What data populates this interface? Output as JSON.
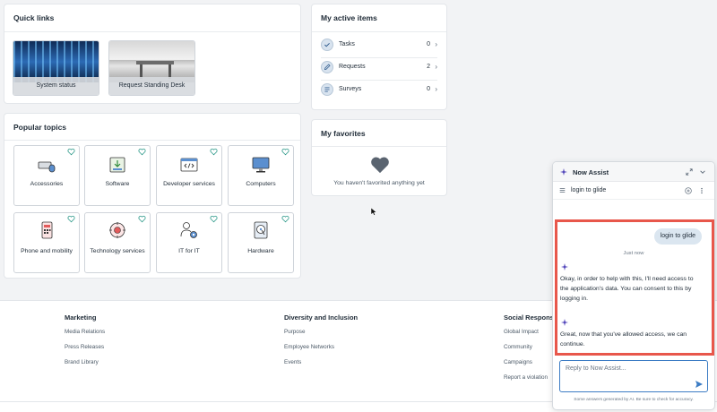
{
  "quick_links": {
    "title": "Quick links",
    "tiles": [
      {
        "label": "System status"
      },
      {
        "label": "Request Standing Desk"
      }
    ]
  },
  "popular_topics": {
    "title": "Popular topics",
    "tiles": [
      {
        "label": "Accessories",
        "icon": "keyboard-mouse-icon"
      },
      {
        "label": "Software",
        "icon": "software-download-icon"
      },
      {
        "label": "Developer services",
        "icon": "code-window-icon"
      },
      {
        "label": "Computers",
        "icon": "monitor-icon"
      },
      {
        "label": "Phone and mobility",
        "icon": "phone-icon"
      },
      {
        "label": "Technology services",
        "icon": "tech-gear-icon"
      },
      {
        "label": "IT for IT",
        "icon": "user-gear-icon"
      },
      {
        "label": "Hardware",
        "icon": "hard-drive-icon"
      }
    ]
  },
  "active_items": {
    "title": "My active items",
    "items": [
      {
        "label": "Tasks",
        "count": "0",
        "icon": "task-check-icon"
      },
      {
        "label": "Requests",
        "count": "2",
        "icon": "request-pencil-icon"
      },
      {
        "label": "Surveys",
        "count": "0",
        "icon": "survey-list-icon"
      }
    ]
  },
  "favorites": {
    "title": "My favorites",
    "empty_text": "You haven't favorited anything yet"
  },
  "footer": {
    "columns": [
      {
        "heading": "Marketing",
        "links": [
          "Media Relations",
          "Press Releases",
          "Brand Library"
        ]
      },
      {
        "heading": "Diversity and Inclusion",
        "links": [
          "Purpose",
          "Employee Networks",
          "Events"
        ]
      },
      {
        "heading": "Social Responsibi",
        "links": [
          "Global Impact",
          "Community",
          "Campaigns",
          "Report a violation"
        ]
      }
    ]
  },
  "now_assist": {
    "title": "Now Assist",
    "conversation_title": "login to glide",
    "user_message": "login to glide",
    "timestamp": "Just now",
    "messages": [
      "Okay, in order to help with this, I'll need access to the application's data. You can consent to this by logging in.",
      "Great, now that you've allowed access, we can continue."
    ],
    "input_placeholder": "Reply to Now Assist...",
    "disclaimer": "Some answers generated by AI. Be sure to check for accuracy."
  },
  "colors": {
    "accent": "#3c7cc4",
    "highlight": "#e8574b",
    "favorite_heart": "#2e9a8a"
  }
}
